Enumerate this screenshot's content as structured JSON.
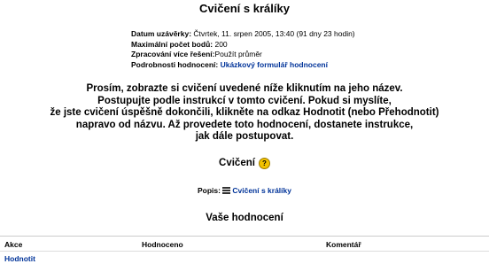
{
  "page": {
    "title": "Cvičení s králíky"
  },
  "meta": {
    "due_label": "Datum uzávěrky:",
    "due_value": "Čtvrtek, 11. srpen 2005, 13:40 (91 dny 23 hodin)",
    "max_label": "Maximální počet bodů:",
    "max_value": "200",
    "multi_label": "Zpracování více řešení:",
    "multi_value": "Použít průměr",
    "details_label": "Podrobnosti hodnocení:",
    "details_link": "Ukázkový formulář hodnocení"
  },
  "instructions": {
    "lines": [
      "Prosím, zobrazte si cvičení uvedené níže kliknutím na jeho název.",
      "Postupujte podle instrukcí v tomto cvičení. Pokud si myslíte,",
      "že jste cvičení úspěšně dokončili, klikněte na odkaz Hodnotit (nebo Přehodnotit)",
      "napravo od názvu. Až provedete toto hodnocení, dostanete instrukce,",
      "jak dále postupovat."
    ]
  },
  "exercise": {
    "heading": "Cvičení",
    "help_icon": "help-icon",
    "popis_label": "Popis:",
    "popis_link": "Cvičení s králíky",
    "popis_icon": "list-icon"
  },
  "assessments": {
    "heading": "Vaše hodnocení",
    "columns": [
      "Akce",
      "Hodnoceno",
      "Komentář"
    ],
    "rows": [
      {
        "action": "Hodnotit"
      }
    ]
  }
}
